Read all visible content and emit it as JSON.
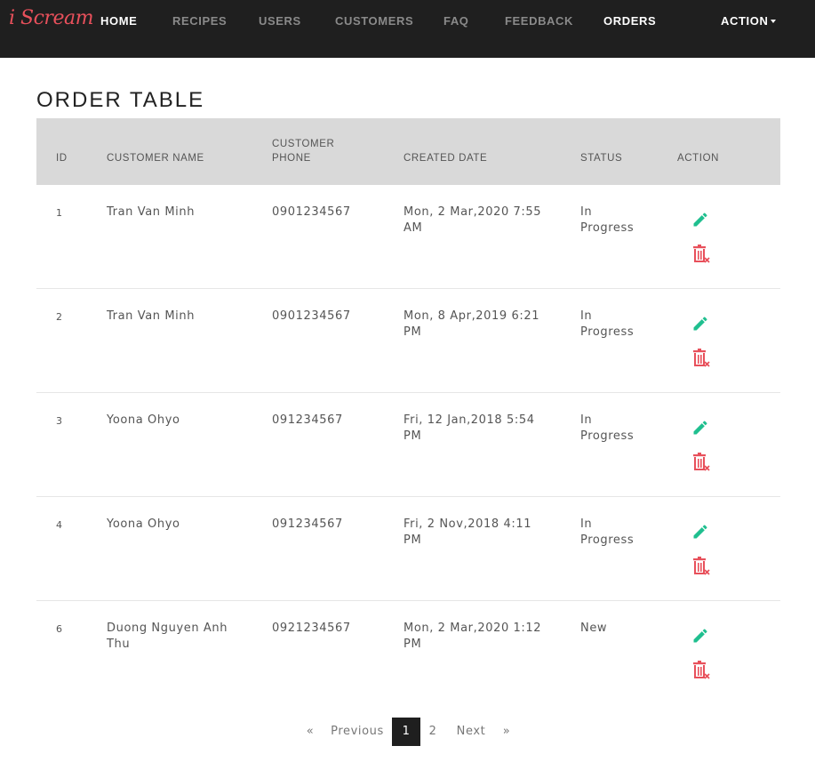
{
  "nav": {
    "brand": "i Scream",
    "items": [
      {
        "label": "HOME"
      },
      {
        "label": "RECIPES"
      },
      {
        "label": "USERS"
      },
      {
        "label": "CUSTOMERS"
      },
      {
        "label": "FAQ"
      },
      {
        "label": "FEEDBACK"
      },
      {
        "label": "ORDERS"
      },
      {
        "label": "ACTION"
      }
    ]
  },
  "page": {
    "title": "ORDER TABLE"
  },
  "table": {
    "headers": {
      "id": "ID",
      "customer_name": "CUSTOMER NAME",
      "customer_phone_1": "CUSTOMER",
      "customer_phone_2": "PHONE",
      "created_date": "CREATED DATE",
      "status": "STATUS",
      "action": "ACTION"
    },
    "rows": [
      {
        "id": "1",
        "name_1": "Tran Van Minh",
        "name_2": "",
        "phone": "0901234567",
        "date_1": "Mon, 2 Mar,2020 7:55",
        "date_2": "AM",
        "status_1": "In",
        "status_2": "Progress"
      },
      {
        "id": "2",
        "name_1": "Tran Van Minh",
        "name_2": "",
        "phone": "0901234567",
        "date_1": "Mon, 8 Apr,2019 6:21",
        "date_2": "PM",
        "status_1": "In",
        "status_2": "Progress"
      },
      {
        "id": "3",
        "name_1": "Yoona Ohyo",
        "name_2": "",
        "phone": "091234567",
        "date_1": "Fri, 12 Jan,2018 5:54",
        "date_2": "PM",
        "status_1": "In",
        "status_2": "Progress"
      },
      {
        "id": "4",
        "name_1": "Yoona Ohyo",
        "name_2": "",
        "phone": "091234567",
        "date_1": "Fri, 2 Nov,2018 4:11",
        "date_2": "PM",
        "status_1": "In",
        "status_2": "Progress"
      },
      {
        "id": "6",
        "name_1": "Duong Nguyen Anh",
        "name_2": "Thu",
        "phone": "0921234567",
        "date_1": "Mon, 2 Mar,2020 1:12",
        "date_2": "PM",
        "status_1": "New",
        "status_2": ""
      }
    ]
  },
  "pagination": {
    "first": "«",
    "previous": "Previous",
    "pages": [
      "1",
      "2"
    ],
    "next": "Next",
    "last": "»"
  },
  "colors": {
    "navbar": "#1f1f1f",
    "brand": "#e8505b",
    "edit_icon": "#1fbf8f",
    "delete_icon": "#e8505b",
    "header_bg": "#d9d9d9"
  }
}
